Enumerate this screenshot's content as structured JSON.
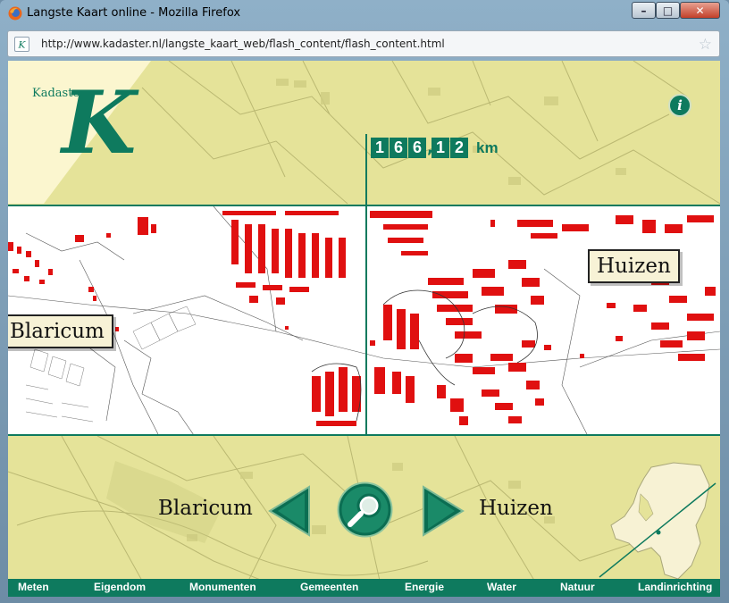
{
  "window": {
    "title": "Langste Kaart online - Mozilla Firefox",
    "url": "http://www.kadaster.nl/langste_kaart_web/flash_content/flash_content.html",
    "controls": {
      "minimize": "–",
      "maximize": "□",
      "close": "✕"
    }
  },
  "app": {
    "logo_small": "Kadaster",
    "logo_letter": "K",
    "info_label": "i",
    "counter": {
      "digits": [
        "1",
        "6",
        "6",
        ",",
        "1",
        "2"
      ],
      "unit": "km"
    },
    "callouts": {
      "right": "Huizen",
      "left": "Blaricum"
    },
    "nav": {
      "from": "Blaricum",
      "to": "Huizen"
    },
    "menu": [
      "Meten",
      "Eigendom",
      "Monumenten",
      "Gemeenten",
      "Energie",
      "Water",
      "Natuur",
      "Landinrichting"
    ]
  },
  "colors": {
    "accent": "#0e7a5e",
    "map_bg": "#e8e69c",
    "buildings": "#e01010"
  }
}
